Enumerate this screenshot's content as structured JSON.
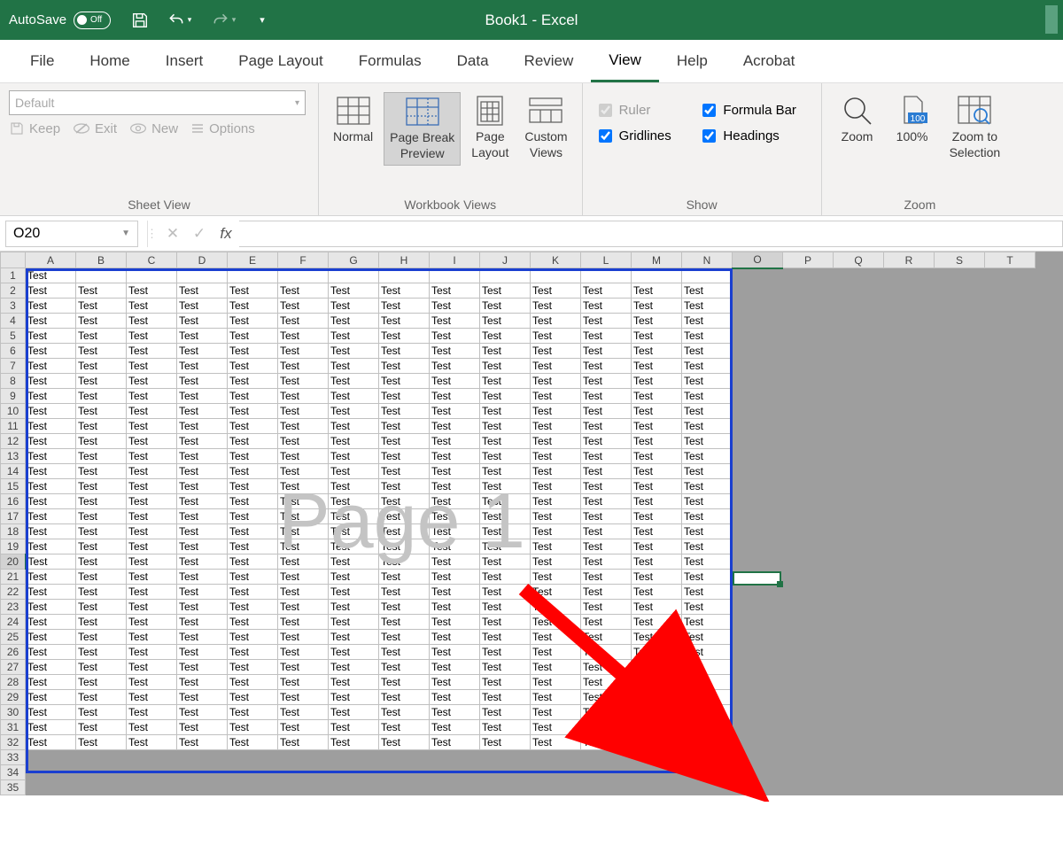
{
  "title_bar": {
    "autosave_label": "AutoSave",
    "autosave_state": "Off",
    "doc_title": "Book1 - Excel"
  },
  "ribbon_tabs": [
    "File",
    "Home",
    "Insert",
    "Page Layout",
    "Formulas",
    "Data",
    "Review",
    "View",
    "Help",
    "Acrobat"
  ],
  "active_tab": "View",
  "sheet_view": {
    "dropdown": "Default",
    "keep": "Keep",
    "exit": "Exit",
    "new": "New",
    "options": "Options",
    "group_label": "Sheet View"
  },
  "wb_views": {
    "normal": "Normal",
    "page_break": "Page Break\nPreview",
    "page_layout": "Page\nLayout",
    "custom": "Custom\nViews",
    "group_label": "Workbook Views"
  },
  "show": {
    "ruler": "Ruler",
    "formula_bar": "Formula Bar",
    "gridlines": "Gridlines",
    "headings": "Headings",
    "group_label": "Show"
  },
  "zoom": {
    "zoom": "Zoom",
    "hundred": "100%",
    "to_selection": "Zoom to\nSelection",
    "group_label": "Zoom"
  },
  "name_box": "O20",
  "columns": [
    "A",
    "B",
    "C",
    "D",
    "E",
    "F",
    "G",
    "H",
    "I",
    "J",
    "K",
    "L",
    "M",
    "N",
    "O",
    "P",
    "Q",
    "R",
    "S",
    "T"
  ],
  "rows": 35,
  "data_rows": 32,
  "data_cols": 14,
  "cell_text": "Test",
  "watermark": "Page 1",
  "selected": {
    "col": "O",
    "row": 20
  }
}
